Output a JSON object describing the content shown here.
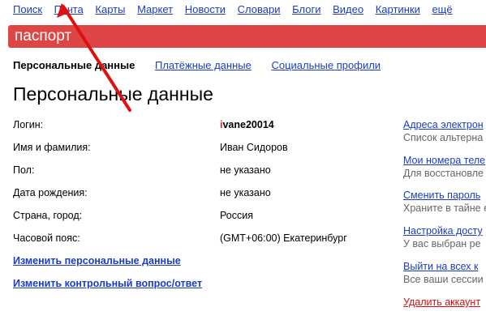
{
  "topnav": [
    "Поиск",
    "Почта",
    "Карты",
    "Маркет",
    "Новости",
    "Словари",
    "Блоги",
    "Видео",
    "Картинки",
    "ещё"
  ],
  "header": {
    "title": "паспорт"
  },
  "tabs": {
    "active": "Персональные данные",
    "payment": "Платёжные данные",
    "social": "Социальные профили"
  },
  "page": {
    "heading": "Персональные данные"
  },
  "profile": {
    "login_label": "Логин:",
    "login_first": "i",
    "login_rest": "vane20014",
    "name_label": "Имя и фамилия:",
    "name_value": "Иван Сидоров",
    "gender_label": "Пол:",
    "gender_value": "не указано",
    "birth_label": "Дата рождения:",
    "birth_value": "не указано",
    "country_label": "Страна, город:",
    "country_value": "Россия",
    "tz_label": "Часовой пояс:",
    "tz_value": "(GMT+06:00) Екатеринбург"
  },
  "actions": {
    "edit_personal": "Изменить персональные данные",
    "edit_question": "Изменить контрольный вопрос/ответ"
  },
  "sidebar": {
    "email_link": "Адреса электрон",
    "email_sub": "Список альтерна",
    "phones_link": "Мои номера теле",
    "phones_sub": "Для восстановле",
    "password_link": "Сменить пароль",
    "password_sub": "Храните в тайне е",
    "access_link": "Настройка досту",
    "access_sub": "У вас выбран ре",
    "logout_link": "Выйти на всех к",
    "logout_sub": "Все ваши сессии",
    "delete_link": "Удалить аккаунт"
  },
  "colors": {
    "brand_red": "#e04545",
    "link_blue": "#1a3dc1",
    "arrow_red": "#e01010"
  }
}
